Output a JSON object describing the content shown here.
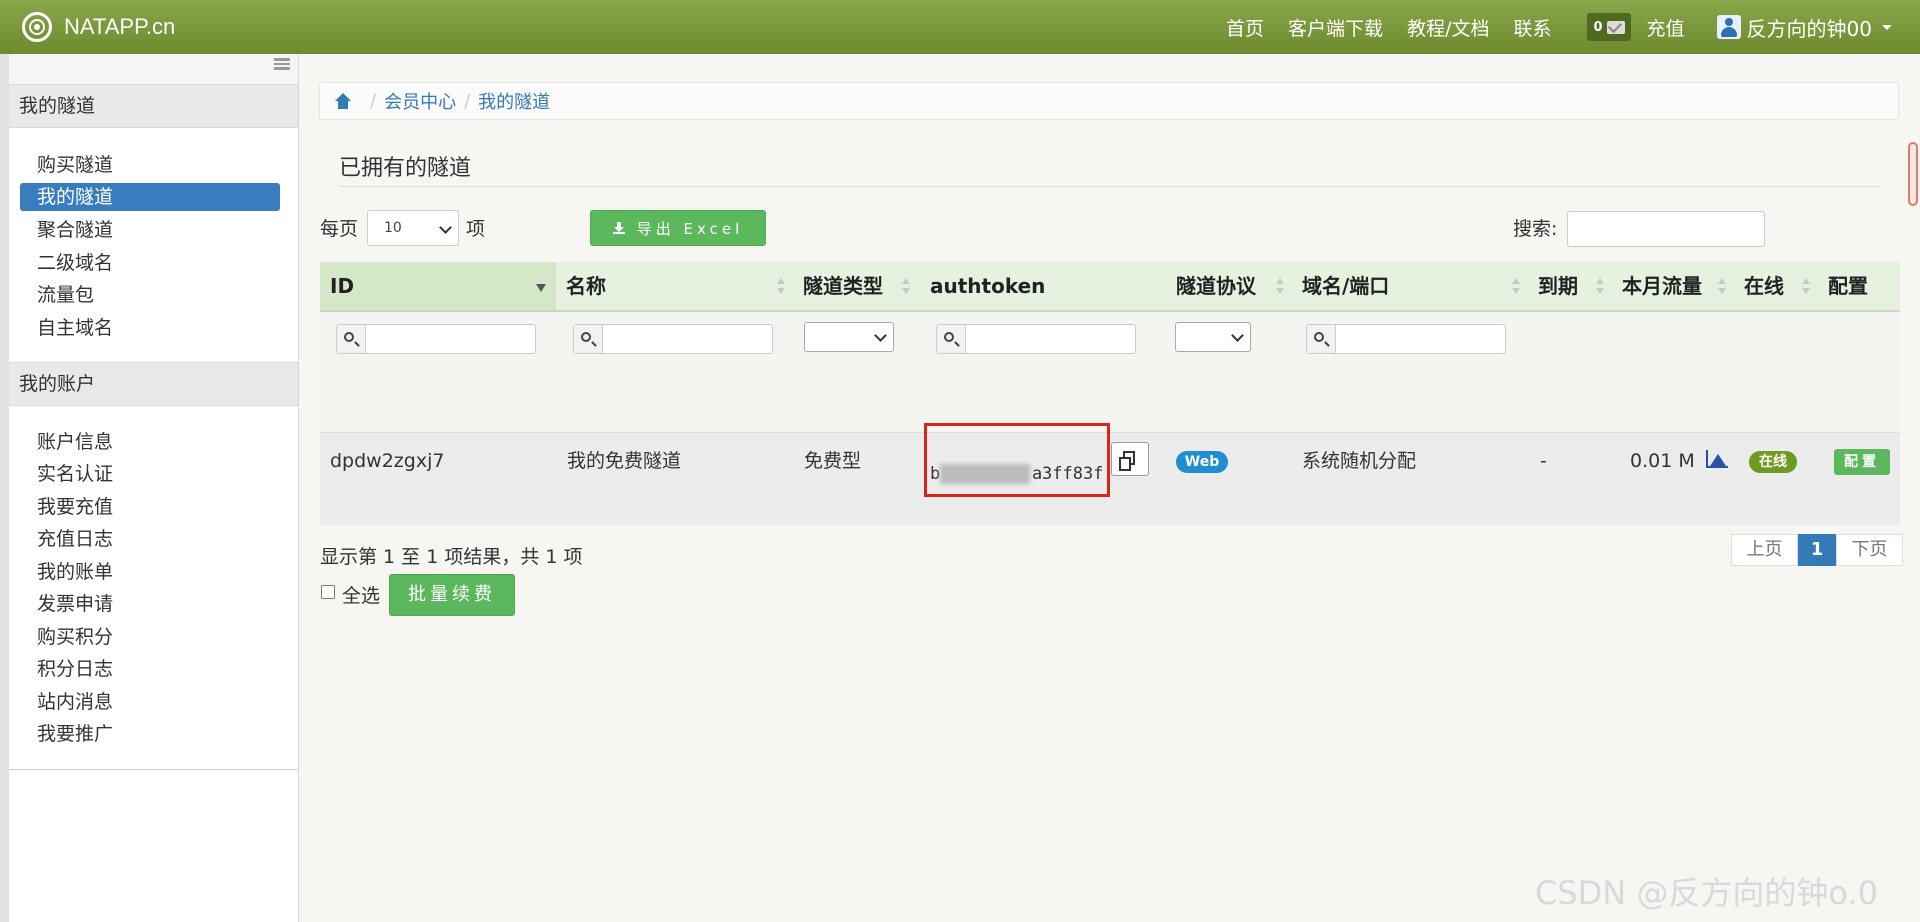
{
  "navbar": {
    "brand": "NATAPP.cn",
    "links": [
      "首页",
      "客户端下载",
      "教程/文档",
      "联系"
    ],
    "msg_count": "0",
    "recharge": "充值",
    "user": "反方向的钟00"
  },
  "sidebar": {
    "group1": "我的隧道",
    "tunnel_items": [
      "购买隧道",
      "我的隧道",
      "聚合隧道",
      "二级域名",
      "流量包",
      "自主域名"
    ],
    "group2": "我的账户",
    "account_items": [
      "账户信息",
      "实名认证",
      "我要充值",
      "充值日志",
      "我的账单",
      "发票申请",
      "购买积分",
      "积分日志",
      "站内消息",
      "我要推广"
    ]
  },
  "breadcrumb": [
    "会员中心",
    "我的隧道"
  ],
  "page_title": "已拥有的隧道",
  "controls": {
    "per_page_label": "每页",
    "per_page_value": "10",
    "per_page_unit": "项",
    "export_label": "导出 Excel",
    "search_label": "搜索:"
  },
  "table": {
    "headers": [
      "ID",
      "名称",
      "隧道类型",
      "authtoken",
      "隧道协议",
      "域名/端口",
      "到期",
      "本月流量",
      "在线",
      "配置"
    ],
    "row": {
      "id": "dpdw2zgxj7",
      "name": "我的免费隧道",
      "type": "免费型",
      "token_start": "b",
      "token_mid": "a",
      "token_end": "3ff83f",
      "protocol": "Web",
      "domain": "系统随机分配",
      "expire": "-",
      "traffic": "0.01 M",
      "online": "在线",
      "config": "配置"
    }
  },
  "footer": {
    "summary": "显示第 1 至 1 项结果，共 1 项",
    "select_all": "全选",
    "renew": "批量续费",
    "prev": "上页",
    "page": "1",
    "next": "下页"
  },
  "watermark": "CSDN @反方向的钟o.0"
}
